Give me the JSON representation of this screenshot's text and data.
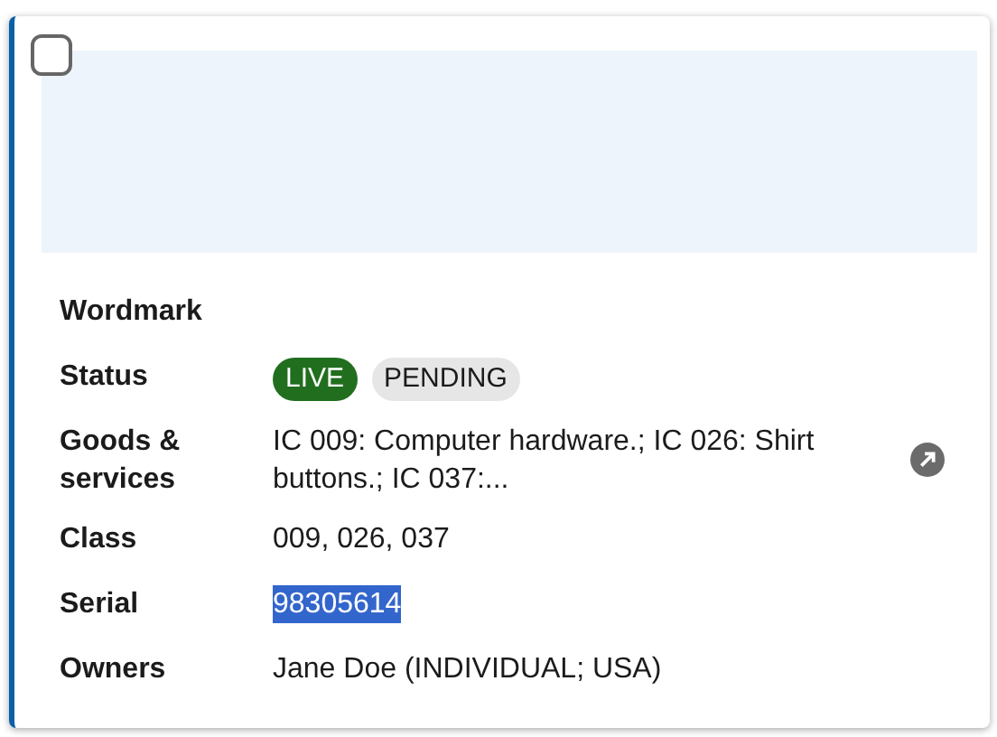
{
  "card": {
    "checked": false,
    "fields": [
      {
        "label": "Wordmark"
      },
      {
        "label": "Status",
        "tags": [
          {
            "text": "LIVE",
            "kind": "live"
          },
          {
            "text": "PENDING",
            "kind": "pending"
          }
        ]
      },
      {
        "label": "Goods & services",
        "value": "IC 009: Computer hardware.; IC 026: Shirt buttons.; IC 037:...",
        "link": true
      },
      {
        "label": "Class",
        "value": "009, 026, 037"
      },
      {
        "label": "Serial",
        "value": "98305614",
        "highlighted": true
      },
      {
        "label": "Owners",
        "value": "Jane Doe (INDIVIDUAL; USA)"
      }
    ]
  }
}
